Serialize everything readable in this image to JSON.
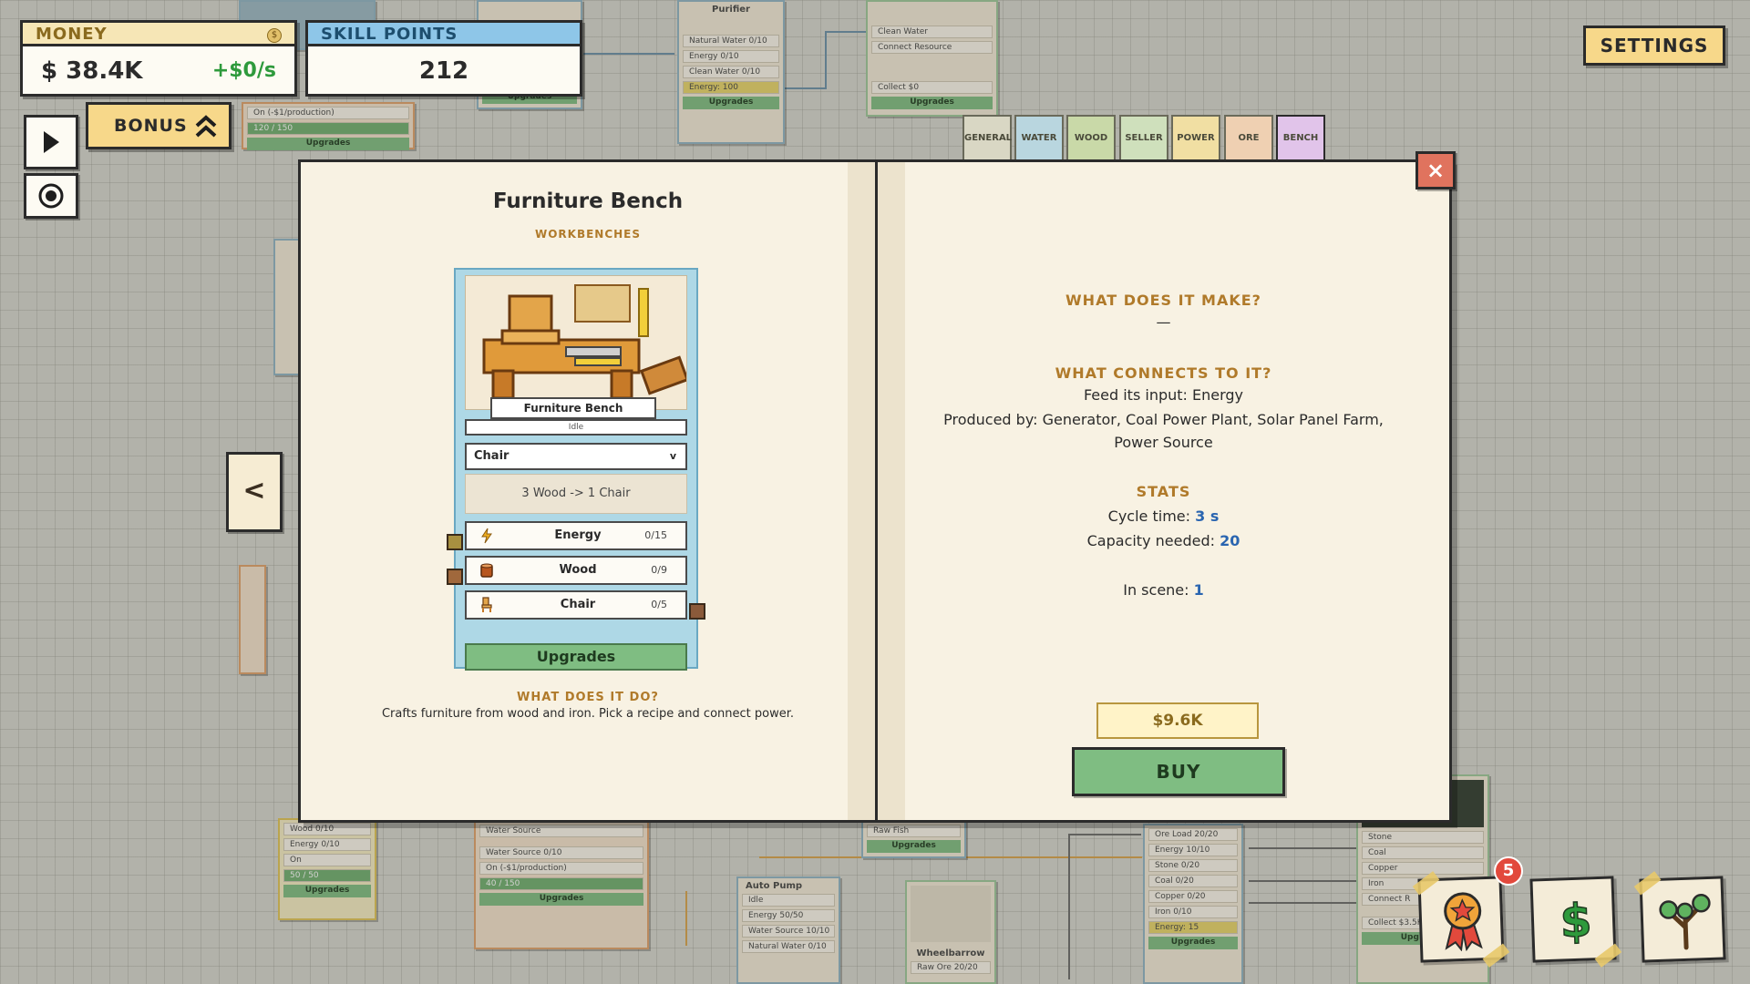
{
  "hud": {
    "money_label": "MONEY",
    "money_value": "$ 38.4K",
    "money_rate": "+$0/s",
    "coin_symbol": "$",
    "skill_label": "SKILL POINTS",
    "skill_value": "212",
    "bonus_label": "BONUS",
    "settings_label": "SETTINGS"
  },
  "tabs": [
    {
      "label": "GENERAL",
      "color": "#d9d7c4"
    },
    {
      "label": "WATER",
      "color": "#b9d6df"
    },
    {
      "label": "WOOD",
      "color": "#c9d9a8"
    },
    {
      "label": "SELLER",
      "color": "#cfe0bc"
    },
    {
      "label": "POWER",
      "color": "#f1dfa3"
    },
    {
      "label": "ORE",
      "color": "#efd0b2"
    },
    {
      "label": "BENCH",
      "color": "#e1c4ea"
    }
  ],
  "book": {
    "close_label": "×",
    "prev_label": "<",
    "item": {
      "title": "Furniture Bench",
      "category": "WORKBENCHES",
      "card_name": "Furniture Bench",
      "status": "Idle",
      "recipe_selected": "Chair",
      "recipe_desc": "3 Wood  -> 1 Chair",
      "ports": [
        {
          "label": "Energy",
          "value": "0/15"
        },
        {
          "label": "Wood",
          "value": "0/9"
        },
        {
          "label": "Chair",
          "value": "0/5"
        }
      ],
      "upgrades_label": "Upgrades",
      "what_does_head": "WHAT DOES IT DO?",
      "what_does_text": "Crafts furniture from wood and iron. Pick a recipe and connect power."
    },
    "right": {
      "makes_head": "WHAT DOES IT MAKE?",
      "makes_value": "—",
      "connects_head": "WHAT CONNECTS TO IT?",
      "feed_line": "Feed its input: Energy",
      "produced_line1": "Produced by: Generator, Coal Power Plant, Solar Panel Farm,",
      "produced_line2": "Power Source",
      "stats_head": "STATS",
      "cycle_label": "Cycle time:",
      "cycle_value": "3 s",
      "capacity_label": "Capacity needed:",
      "capacity_value": "20",
      "scene_label": "In scene:",
      "scene_value": "1",
      "price": "$9.6K",
      "buy_label": "BUY"
    }
  },
  "corner": {
    "notification_count": "5"
  },
  "background_nodes": {
    "n1": {
      "rows": [
        "On (-$1/production)",
        "120 / 150"
      ],
      "button": "Upgrades"
    },
    "n2": {
      "rows": [
        "Purifier",
        "Natural Water  0/10",
        "Energy  0/10",
        "Clean Water  0/10",
        "Energy: 100"
      ],
      "button": "Upgrades"
    },
    "n3": {
      "rows": [
        "Clean Water",
        "Connect Resource",
        "Collect $0"
      ],
      "button": "Upgrades"
    },
    "n4": {
      "rows": [
        "Wood  0/10",
        "Energy  0/10",
        "On",
        "50 / 50"
      ],
      "button": "Upgrades"
    },
    "n5": {
      "rows": [
        "Water Source",
        "Water Source  0/10",
        "On (-$1/production)",
        "40 / 150"
      ],
      "button": "Upgrades"
    },
    "n6": {
      "title": "Auto Pump",
      "rows": [
        "Idle",
        "Energy  50/50",
        "Water Source  10/10",
        "Natural Water  0/10"
      ]
    },
    "n7": {
      "title": "Wheelbarrow",
      "rows": [
        "Raw Ore  20/20"
      ]
    },
    "n8": {
      "rows": [
        "Raw Fish"
      ],
      "button": "Upgrades"
    },
    "n9": {
      "rows": [
        "Ore Load  20/20",
        "Energy  10/10",
        "Stone  0/20",
        "Coal  0/20",
        "Copper  0/20",
        "Iron  0/10",
        "Energy: 15"
      ],
      "button": "Upgrades"
    },
    "n10": {
      "rows": [
        "Stone",
        "Coal",
        "Copper",
        "Iron",
        "Connect R",
        "Collect $3.5K"
      ],
      "button": "Upgrades"
    }
  }
}
